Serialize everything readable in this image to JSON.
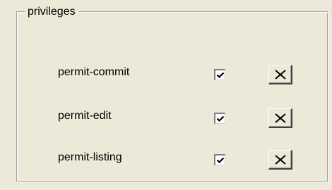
{
  "group": {
    "title": "privileges"
  },
  "privileges": [
    {
      "label": "permit-commit",
      "checked": true,
      "delete_icon": "close-x-icon"
    },
    {
      "label": "permit-edit",
      "checked": true,
      "delete_icon": "close-x-icon"
    },
    {
      "label": "permit-listing",
      "checked": true,
      "delete_icon": "close-x-icon"
    }
  ],
  "colors": {
    "window_bg": "#ece9d8",
    "checkbox_bg": "#ffffff",
    "border_dark": "#808080"
  }
}
